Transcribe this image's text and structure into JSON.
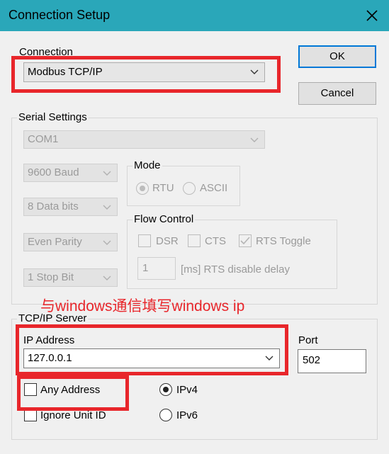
{
  "window": {
    "title": "Connection Setup"
  },
  "connection": {
    "label": "Connection",
    "selected": "Modbus TCP/IP"
  },
  "buttons": {
    "ok": "OK",
    "cancel": "Cancel"
  },
  "serial": {
    "label": "Serial Settings",
    "port": "COM1",
    "baud": "9600 Baud",
    "data_bits": "8 Data bits",
    "parity": "Even Parity",
    "stop_bits": "1 Stop Bit",
    "mode": {
      "label": "Mode",
      "rtu": "RTU",
      "ascii": "ASCII"
    },
    "flow": {
      "label": "Flow Control",
      "dsr": "DSR",
      "cts": "CTS",
      "rts_toggle": "RTS Toggle",
      "delay_value": "1",
      "delay_label": "[ms] RTS disable delay"
    }
  },
  "annotation": {
    "text": "与windows通信填写windows ip",
    "color": "#e8262b"
  },
  "tcp": {
    "label": "TCP/IP Server",
    "ip_label": "IP Address",
    "ip_value": "127.0.0.1",
    "port_label": "Port",
    "port_value": "502",
    "any_address": "Any Address",
    "ignore_unit": "Ignore Unit ID",
    "ipv4": "IPv4",
    "ipv6": "IPv6"
  },
  "colors": {
    "titlebar": "#2aa7b9",
    "highlight": "#e8262b",
    "focus": "#0078d7"
  }
}
